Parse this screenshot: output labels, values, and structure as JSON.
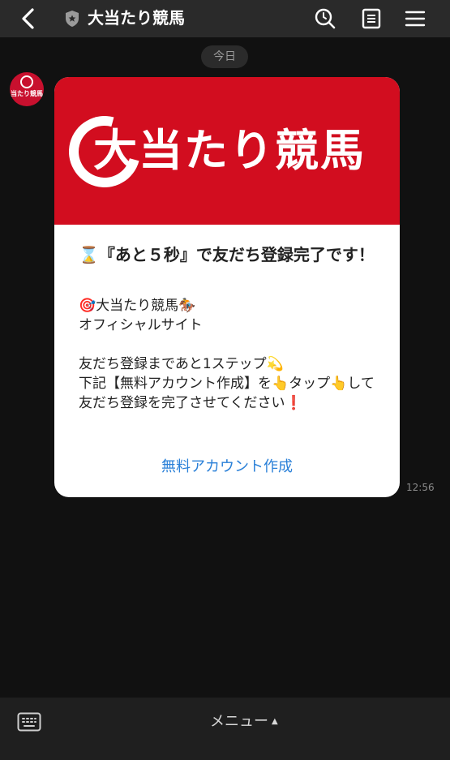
{
  "header": {
    "title": "大当たり競馬",
    "icons": {
      "back": "chevron-left-icon",
      "badge": "shield-star-icon",
      "search": "search-icon",
      "notes": "notes-icon",
      "menu": "hamburger-menu-icon"
    }
  },
  "date_label": "今日",
  "avatar": {
    "text": "当たり競馬"
  },
  "card": {
    "hero_text": "大当たり競馬",
    "title": "⌛『あと５秒』で友だち登録完了です！",
    "body": {
      "line1": "🎯大当たり競馬🏇",
      "line2": "オフィシャルサイト",
      "line3": "友だち登録まであと1ステップ💫",
      "line4": "下記【無料アカウント作成】を👆タップ👆して友だち登録を完了させてください❗"
    },
    "cta_label": "無料アカウント作成"
  },
  "timestamp": "12:56",
  "bottom": {
    "menu_label": "メニュー",
    "caret": "▲",
    "keyboard_icon": "keyboard-icon"
  },
  "colors": {
    "brand_red": "#d20d1f",
    "link_blue": "#2a80d8",
    "background": "#111111",
    "header": "#2a2a2a"
  }
}
